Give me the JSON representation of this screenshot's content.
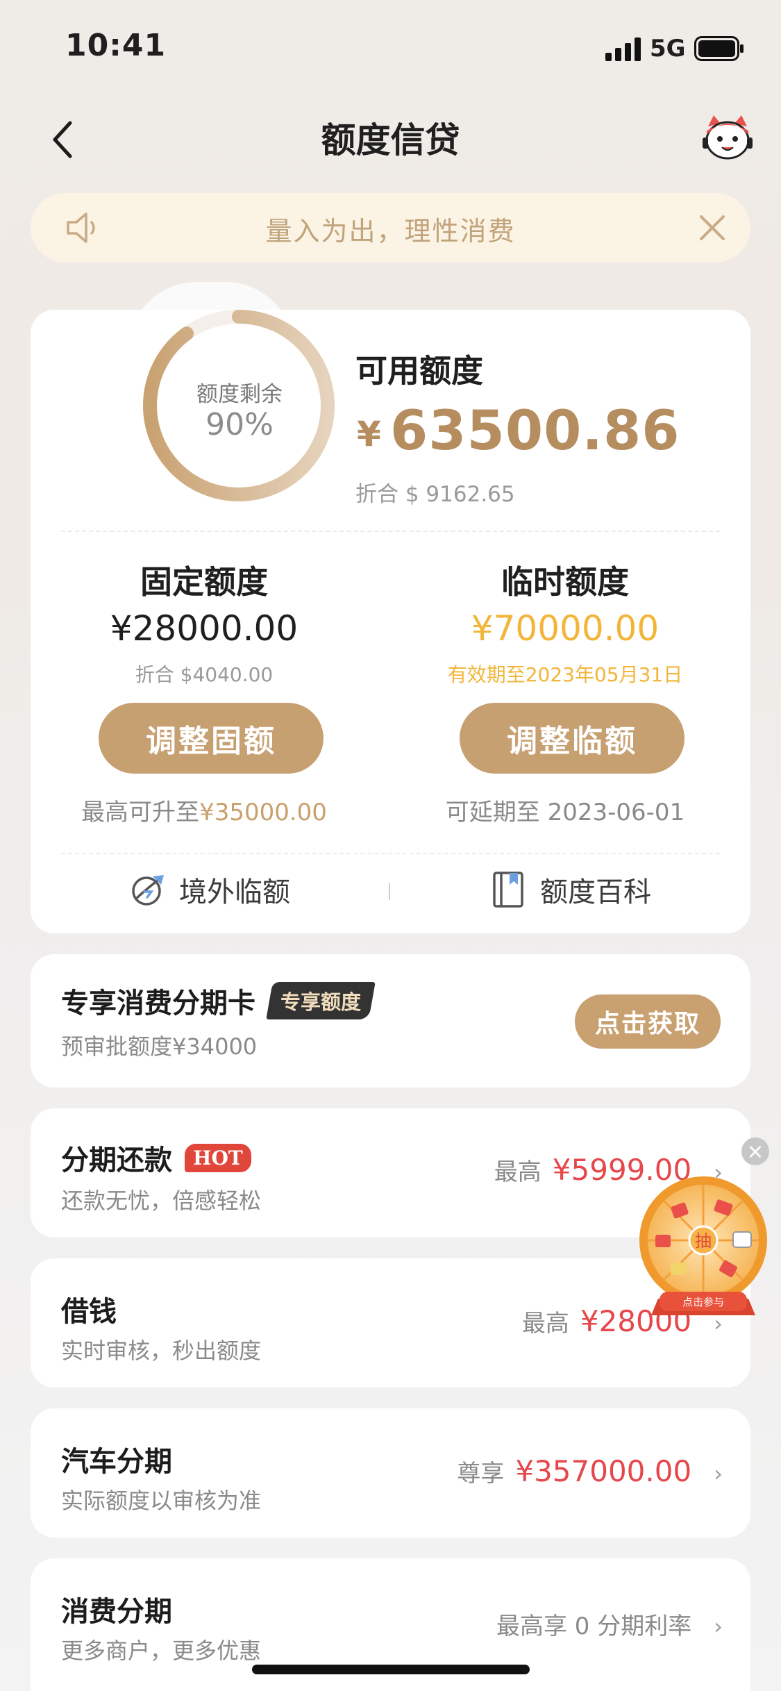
{
  "status_bar": {
    "time": "10:41",
    "network": "5G"
  },
  "nav": {
    "title": "额度信贷",
    "back_icon": "chevron-left-icon",
    "mascot_icon": "mascot-avatar-icon"
  },
  "notice": {
    "text": "量入为出，理性消费",
    "icon": "speaker-icon",
    "close_icon": "close-icon"
  },
  "credit": {
    "ring_label": "额度剩余",
    "ring_value": "90%",
    "ring_fraction": 0.9,
    "available_label": "可用额度",
    "available_currency": "¥",
    "available_amount": "63500.86",
    "available_converted": "折合 $ 9162.65",
    "fixed": {
      "title": "固定额度",
      "amount": "¥28000.00",
      "converted": "折合 $4040.00",
      "button": "调整固额",
      "foot_prefix": "最高可升至",
      "foot_value": "¥35000.00"
    },
    "temp": {
      "title": "临时额度",
      "amount": "¥70000.00",
      "validity": "有效期至2023年05月31日",
      "button": "调整临额",
      "foot": "可延期至 2023-06-01"
    },
    "links": [
      {
        "label": "境外临额",
        "icon": "globe-plane-icon"
      },
      {
        "label": "额度百科",
        "icon": "book-icon"
      }
    ]
  },
  "promo_card": {
    "title": "专享消费分期卡",
    "badge": "专享额度",
    "subtitle": "预审批额度¥34000",
    "button": "点击获取"
  },
  "products": [
    {
      "title": "分期还款",
      "badge": "HOT",
      "subtitle": "还款无忧，倍感轻松",
      "prefix": "最高",
      "value": "¥5999.00"
    },
    {
      "title": "借钱",
      "subtitle": "实时审核，秒出额度",
      "prefix": "最高",
      "value": "¥28000"
    },
    {
      "title": "汽车分期",
      "subtitle": "实际额度以审核为准",
      "prefix": "尊享",
      "value": "¥357000.00"
    },
    {
      "title": "消费分期",
      "subtitle": "更多商户，更多优惠",
      "prefix": "最高享 0 分期利率",
      "value": ""
    }
  ],
  "floating_wheel": {
    "center": "抽",
    "ribbon": "点击参与",
    "close": "×"
  },
  "colors": {
    "accent_gold": "#c7a072",
    "amount_gold": "#b58d5f",
    "orange": "#f2b53a",
    "red": "#e5474b"
  }
}
